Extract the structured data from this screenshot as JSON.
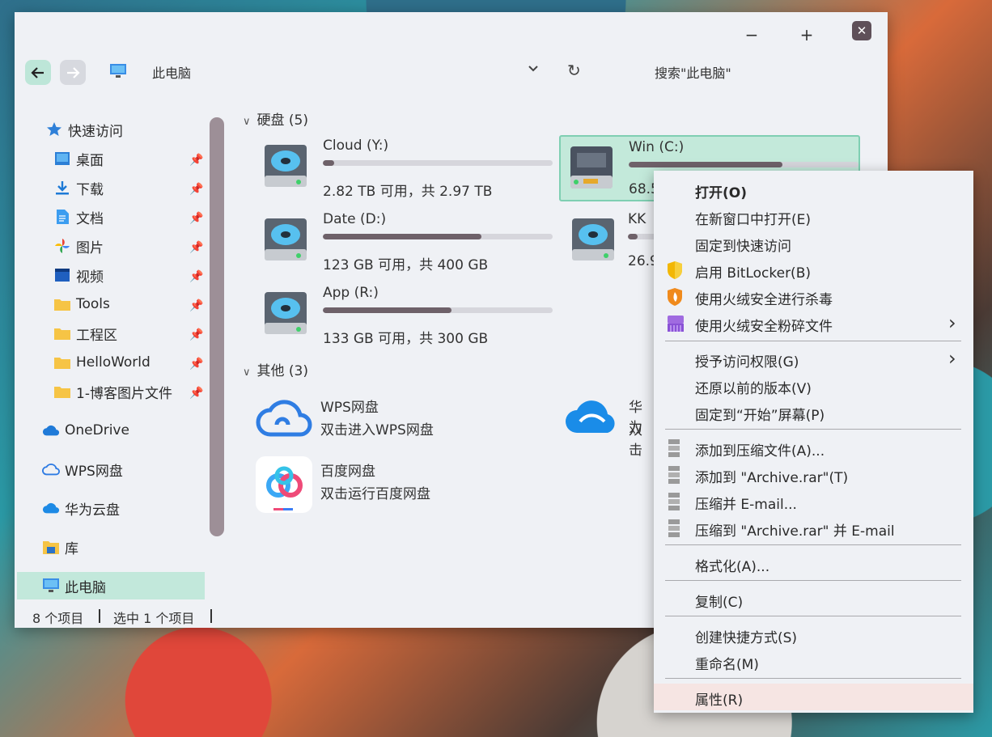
{
  "window": {
    "controls": {
      "minimize": "−",
      "maximize": "+",
      "close": "✕"
    },
    "address": {
      "text": "此电脑",
      "dropdown": "⌄",
      "refresh": "↻"
    },
    "search": {
      "placeholder": "搜索\"此电脑\""
    }
  },
  "sidebar": {
    "quick_access": "快速访问",
    "items": [
      {
        "label": "桌面",
        "icon": "desktop-icon"
      },
      {
        "label": "下载",
        "icon": "download-icon"
      },
      {
        "label": "文档",
        "icon": "document-icon"
      },
      {
        "label": "图片",
        "icon": "pictures-icon"
      },
      {
        "label": "视频",
        "icon": "video-icon"
      },
      {
        "label": "Tools",
        "icon": "folder-icon"
      },
      {
        "label": "工程区",
        "icon": "folder-icon"
      },
      {
        "label": "HelloWorld",
        "icon": "folder-icon"
      },
      {
        "label": "1-博客图片文件",
        "icon": "folder-icon"
      }
    ],
    "onedrive": "OneDrive",
    "wps": "WPS网盘",
    "huawei": "华为云盘",
    "library": "库",
    "this_pc": "此电脑"
  },
  "main": {
    "drives_group": "硬盘 (5)",
    "drives": [
      {
        "name": "Cloud (Y:)",
        "free": "2.82 TB 可用，共 2.97 TB",
        "used_fraction": 0.05
      },
      {
        "name": "Win (C:)",
        "free": "68.5",
        "used_fraction": 0.67
      },
      {
        "name": "Date (D:)",
        "free": "123 GB 可用，共 400 GB",
        "used_fraction": 0.69
      },
      {
        "name": "KK",
        "free": "26.9",
        "used_fraction": 0.11
      },
      {
        "name": "App (R:)",
        "free": "133 GB 可用，共 300 GB",
        "used_fraction": 0.56
      }
    ],
    "other_group": "其他 (3)",
    "others": [
      {
        "name": "WPS网盘",
        "desc": "双击进入WPS网盘"
      },
      {
        "name": "华为",
        "desc": "双击"
      },
      {
        "name": "百度网盘",
        "desc": "双击运行百度网盘"
      }
    ]
  },
  "status": {
    "count": "8 个项目",
    "selected": "选中 1 个项目"
  },
  "context_menu": {
    "items": [
      {
        "label": "打开(O)"
      },
      {
        "label": "在新窗口中打开(E)"
      },
      {
        "label": "固定到快速访问"
      },
      {
        "label": "启用 BitLocker(B)"
      },
      {
        "label": "使用火绒安全进行杀毒"
      },
      {
        "label": "使用火绒安全粉碎文件"
      },
      {
        "label": "授予访问权限(G)"
      },
      {
        "label": "还原以前的版本(V)"
      },
      {
        "label": "固定到“开始”屏幕(P)"
      },
      {
        "label": "添加到压缩文件(A)..."
      },
      {
        "label": "添加到 \"Archive.rar\"(T)"
      },
      {
        "label": "压缩并 E-mail..."
      },
      {
        "label": "压缩到 \"Archive.rar\" 并 E-mail"
      },
      {
        "label": "格式化(A)..."
      },
      {
        "label": "复制(C)"
      },
      {
        "label": "创建快捷方式(S)"
      },
      {
        "label": "重命名(M)"
      },
      {
        "label": "属性(R)"
      }
    ],
    "submenu_arrow": "›"
  }
}
